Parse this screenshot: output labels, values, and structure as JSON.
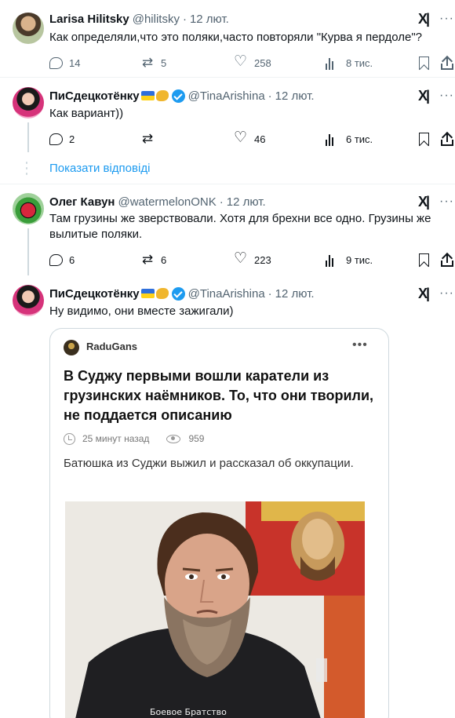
{
  "tweets": [
    {
      "name": "Larisa Hilitsky",
      "handle": "@hilitsky",
      "time": "12 лют.",
      "text": "Как определяли,что это поляки,часто повторяли \"Курва я пердоле\"?",
      "stats": {
        "replies": "14",
        "reposts": "5",
        "likes": "258",
        "views": "8 тис."
      }
    },
    {
      "name": "ПиСдецкотёнку",
      "handle": "@TinaArishina",
      "time": "12 лют.",
      "text": "Как вариант))",
      "stats": {
        "replies": "2",
        "reposts": "",
        "likes": "46",
        "views": "6 тис."
      }
    },
    {
      "name": "Олег Кавун",
      "handle": "@watermelonONK",
      "time": "12 лют.",
      "text": "Там грузины же зверствовали. Хотя для брехни все одно. Грузины же\nвылитые поляки.",
      "stats": {
        "replies": "6",
        "reposts": "6",
        "likes": "223",
        "views": "9 тис."
      }
    },
    {
      "name": "ПиСдецкотёнку",
      "handle": "@TinaArishina",
      "time": "12 лют.",
      "text": "Ну видимо, они вместе зажигали)"
    }
  ],
  "show_replies": "Показати відповіді",
  "embedded_card": {
    "author": "RaduGans",
    "title": "В Суджу первыми вошли каратели из грузинских наёмников. То, что они творили, не поддается описанию",
    "time_ago": "25 минут назад",
    "views": "959",
    "lead": "Батюшка из Суджи выжил и рассказал об оккупации.",
    "photo_caption": "Боевое Братство\nЗА ЛЕГ..."
  },
  "icons": {
    "reply": "reply-icon",
    "repost": "repost-icon",
    "like": "heart-icon",
    "views": "views-icon",
    "bookmark": "bookmark-icon",
    "share": "share-icon",
    "grok": "grok-icon",
    "verified": "verified-badge-icon"
  },
  "colors": {
    "link": "#1d9bf0",
    "muted": "#536471",
    "verified": "#1d9bf0"
  }
}
